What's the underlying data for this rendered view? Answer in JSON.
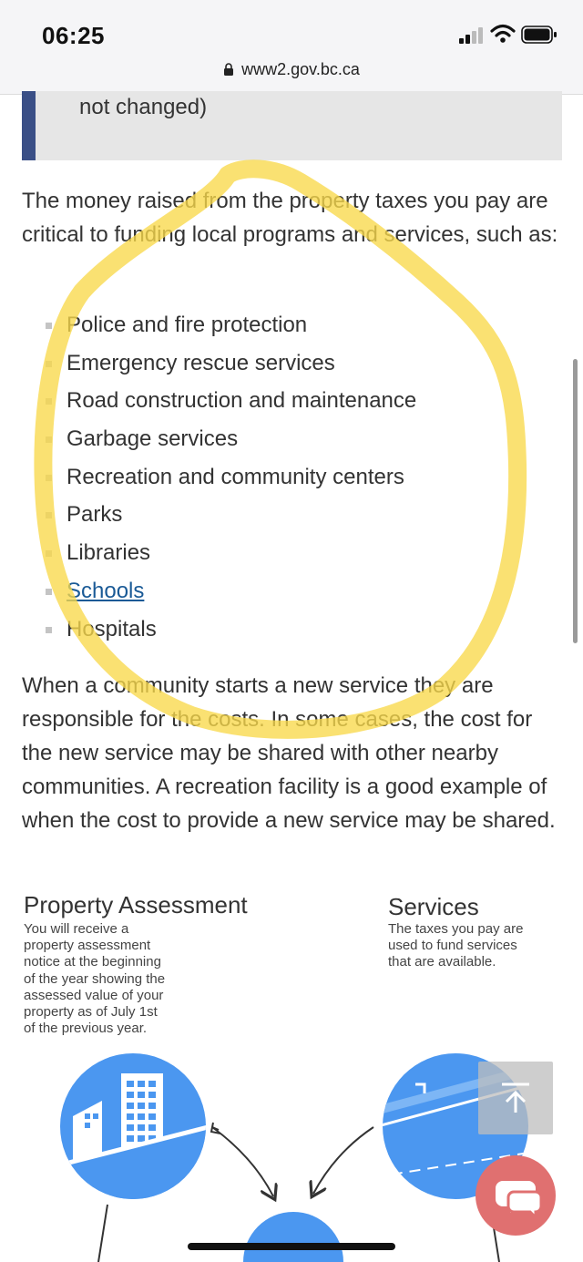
{
  "status_bar": {
    "time": "06:25",
    "url": "www2.gov.bc.ca"
  },
  "callout": {
    "text": "not changed)"
  },
  "intro_paragraph": "The money raised from the property taxes you pay are critical to funding local programs and services, such as:",
  "services_list": [
    {
      "label": "Police and fire protection",
      "link": false
    },
    {
      "label": "Emergency rescue services",
      "link": false
    },
    {
      "label": "Road construction and maintenance",
      "link": false
    },
    {
      "label": "Garbage services",
      "link": false
    },
    {
      "label": "Recreation and community centers",
      "link": false
    },
    {
      "label": "Parks",
      "link": false
    },
    {
      "label": "Libraries",
      "link": false
    },
    {
      "label": "Schools ",
      "link": true
    },
    {
      "label": "Hospitals",
      "link": false
    }
  ],
  "community_paragraph": "When a community starts a new service they are responsible for the costs. In some cases, the cost for the new service may be shared with other nearby communities. A recreation facility is a good example of when the cost to provide a new service may be shared.",
  "infographic": {
    "property_assessment": {
      "title": "Property Assessment",
      "lines": [
        "You will receive a",
        "property assessment",
        "notice at the beginning",
        "of the year showing the",
        "assessed value of your",
        "property as of July 1st",
        "of the previous year."
      ]
    },
    "services": {
      "title": "Services",
      "lines": [
        "The taxes you pay are",
        "used to fund services",
        "that are available."
      ]
    }
  },
  "colors": {
    "link": "#1a5a96",
    "callout_border": "#3a4f86",
    "infographic_blue": "#4b97f0",
    "annotation_highlight": "#f8d94a",
    "chat_button": "#e07070"
  },
  "icons": [
    "lock-icon",
    "signal-icon",
    "wifi-icon",
    "battery-icon",
    "building-icon",
    "scroll-to-top-icon",
    "chat-icon"
  ]
}
